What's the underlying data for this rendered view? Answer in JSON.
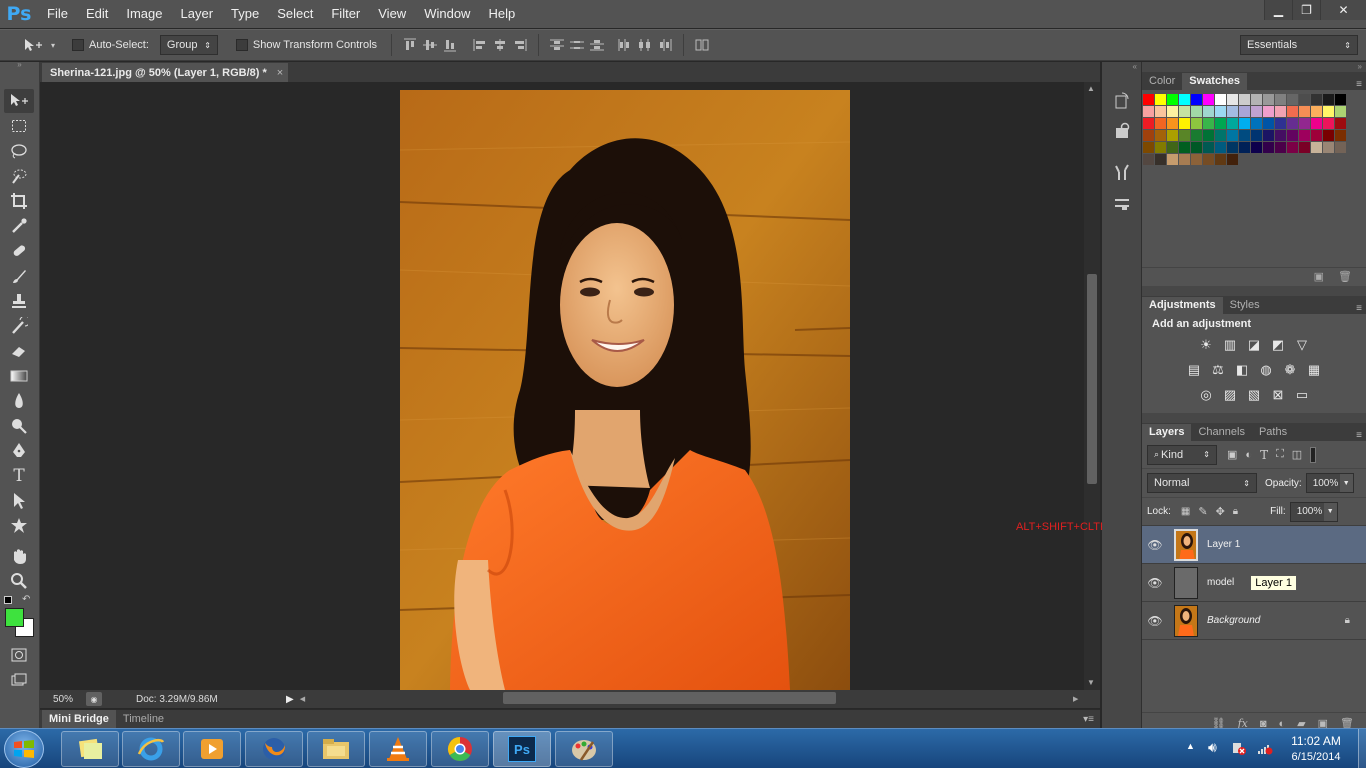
{
  "app": {
    "logo": "Ps"
  },
  "menu": [
    "File",
    "Edit",
    "Image",
    "Layer",
    "Type",
    "Select",
    "Filter",
    "View",
    "Window",
    "Help"
  ],
  "window_controls": {
    "minimize": "▁",
    "restore": "❐",
    "close": "✕"
  },
  "options": {
    "auto_select_label": "Auto-Select:",
    "auto_select_value": "Group",
    "show_transform_label": "Show Transform Controls",
    "workspace": "Essentials"
  },
  "document": {
    "tab_title": "Sherina-121.jpg @ 50% (Layer 1, RGB/8) *",
    "tab_close": "×",
    "zoom": "50%",
    "doc_size": "Doc: 3.29M/9.86M"
  },
  "bottom_tabs": [
    "Mini Bridge",
    "Timeline"
  ],
  "swatches_panel": {
    "tabs": [
      "Color",
      "Swatches"
    ]
  },
  "adjustments_panel": {
    "tabs": [
      "Adjustments",
      "Styles"
    ],
    "heading": "Add an adjustment"
  },
  "layers_panel": {
    "tabs": [
      "Layers",
      "Channels",
      "Paths"
    ],
    "filter_kind": "Kind",
    "blend_mode": "Normal",
    "opacity_label": "Opacity:",
    "opacity_value": "100%",
    "lock_label": "Lock:",
    "fill_label": "Fill:",
    "fill_value": "100%",
    "layers": [
      {
        "name": "Layer 1",
        "selected": true
      },
      {
        "name": "model",
        "selected": false
      },
      {
        "name": "Background",
        "selected": false
      }
    ],
    "tooltip": "Layer 1"
  },
  "annotation": {
    "text": "ALT+SHIFT+CLTR+E",
    "color": "#e02020"
  },
  "colors": {
    "foreground": "#3ee23e",
    "background": "#ffffff",
    "accent": "#3fa9f5"
  },
  "taskbar": {
    "time": "11:02 AM",
    "date": "6/15/2014"
  },
  "swatch_rows": [
    [
      "#ff0000",
      "#ffff00",
      "#00ff00",
      "#00ffff",
      "#0000ff",
      "#ff00ff",
      "#ffffff",
      "#e6e6e6",
      "#cccccc",
      "#b3b3b3",
      "#999999",
      "#808080",
      "#666666",
      "#4d4d4d",
      "#333333",
      "#1a1a1a",
      "#000000"
    ],
    [
      "#f7a1a1",
      "#f9c49c",
      "#fdf0a0",
      "#c6e3a1",
      "#a1d9a6",
      "#9fd6cf",
      "#9cd9f2",
      "#a3bce2",
      "#a9a5d7",
      "#c0a2d1",
      "#ef9fcc",
      "#f3a2b3",
      "#f26c4f",
      "#f68e55",
      "#fbaf5d",
      "#fff568",
      "#acd372"
    ],
    [
      "#ed1c24",
      "#f26522",
      "#f7941d",
      "#fff200",
      "#8dc63f",
      "#39b54a",
      "#00a651",
      "#00a99d",
      "#00aeef",
      "#0072bc",
      "#0054a6",
      "#2e3192",
      "#662d91",
      "#92278f",
      "#ec008c",
      "#ed145b",
      "#9e0b0f"
    ],
    [
      "#a0410d",
      "#a36209",
      "#aba000",
      "#598527",
      "#197b30",
      "#007236",
      "#00746b",
      "#0076a3",
      "#004b80",
      "#003471",
      "#1b1464",
      "#440e62",
      "#630460",
      "#9e005d",
      "#9e0039",
      "#790000",
      "#7b2e00"
    ],
    [
      "#7d4900",
      "#827b00",
      "#406618",
      "#005e20",
      "#005826",
      "#005952",
      "#005b7f",
      "#003663",
      "#002157",
      "#0d004c",
      "#32004b",
      "#4b0049",
      "#7b0046",
      "#7a0026",
      "#c7b299",
      "#998675",
      "#736357"
    ],
    [
      "#534741",
      "#37302a",
      "#c69c6d",
      "#a67c52",
      "#8c6239",
      "#754c24",
      "#603913",
      "#42210b"
    ]
  ]
}
